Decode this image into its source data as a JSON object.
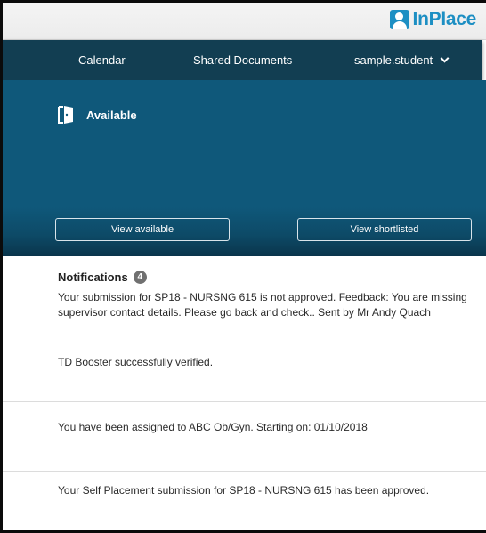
{
  "logo": {
    "text": "InPlace",
    "icon": "person-badge-icon"
  },
  "nav": {
    "calendar": "Calendar",
    "shared_documents": "Shared Documents",
    "user": "sample.student",
    "user_icon": "chevron-down-icon"
  },
  "hero": {
    "available_label": "Available",
    "available_icon": "door-icon",
    "view_available": "View available",
    "view_shortlisted": "View shortlisted"
  },
  "notifications": {
    "title": "Notifications",
    "count": "4",
    "items": [
      {
        "text": "Your submission for SP18 - NURSNG 615 is not approved. Feedback: You are missing supervisor contact details. Please go back and check.. Sent by Mr Andy Quach"
      },
      {
        "text": "TD Booster successfully verified."
      },
      {
        "text": "You have been assigned to ABC Ob/Gyn. Starting on: 01/10/2018"
      },
      {
        "text": "Your Self Placement submission for SP18 - NURSNG 615 has been approved."
      }
    ]
  },
  "colors": {
    "nav_bg": "#123e52",
    "hero_bg": "#0f587a",
    "brand": "#1d8fc3"
  }
}
